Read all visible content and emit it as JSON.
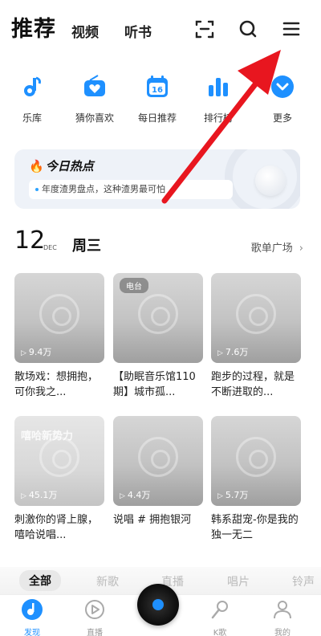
{
  "header": {
    "tabs": [
      {
        "label": "推荐",
        "active": true
      },
      {
        "label": "视频"
      },
      {
        "label": "听书"
      }
    ],
    "icons": [
      "scan-icon",
      "search-icon",
      "menu-icon"
    ]
  },
  "shortcuts": [
    {
      "label": "乐库",
      "icon": "music-note-icon",
      "color": "#1e90ff"
    },
    {
      "label": "猜你喜欢",
      "icon": "radio-heart-icon",
      "color": "#1e90ff"
    },
    {
      "label": "每日推荐",
      "icon": "calendar-icon",
      "color": "#1e90ff",
      "day": "16"
    },
    {
      "label": "排行榜",
      "icon": "chart-bars-icon",
      "color": "#1e90ff"
    },
    {
      "label": "更多",
      "icon": "chevron-down-icon",
      "color": "#1e90ff"
    }
  ],
  "hot": {
    "title": "今日热点",
    "line": "年度渣男盘点，这种渣男最可怕"
  },
  "date": {
    "day": "12",
    "month": "DEC",
    "weekday": "周三",
    "plaza": "歌单广场",
    "chevron": "›"
  },
  "playlists": [
    {
      "plays": "9.4万",
      "title": "散场戏：想拥抱，可你我之..."
    },
    {
      "badge": "电台",
      "title": "【助眠音乐馆110期】城市孤..."
    },
    {
      "plays": "7.6万",
      "title": "跑步的过程，就是不断进取的..."
    },
    {
      "cover_text": "嘻哈新势力",
      "plays": "45.1万",
      "title": "刺激你的肾上腺，嘻哈说唱..."
    },
    {
      "plays": "4.4万",
      "title": "说唱 # 拥抱银河"
    },
    {
      "plays": "5.7万",
      "title": "韩系甜宠-你是我的独一无二"
    }
  ],
  "categories": [
    "全部",
    "新歌",
    "直播",
    "唱片",
    "铃声"
  ],
  "nav": [
    {
      "label": "发现",
      "icon": "music-note-icon",
      "active": true
    },
    {
      "label": "直播",
      "icon": "live-play-icon"
    },
    {
      "label": "",
      "icon": "vinyl-player-icon"
    },
    {
      "label": "K歌",
      "icon": "microphone-icon"
    },
    {
      "label": "我的",
      "icon": "person-icon"
    }
  ],
  "accent_color": "#1e90ff",
  "annotation_color": "#e8161f"
}
